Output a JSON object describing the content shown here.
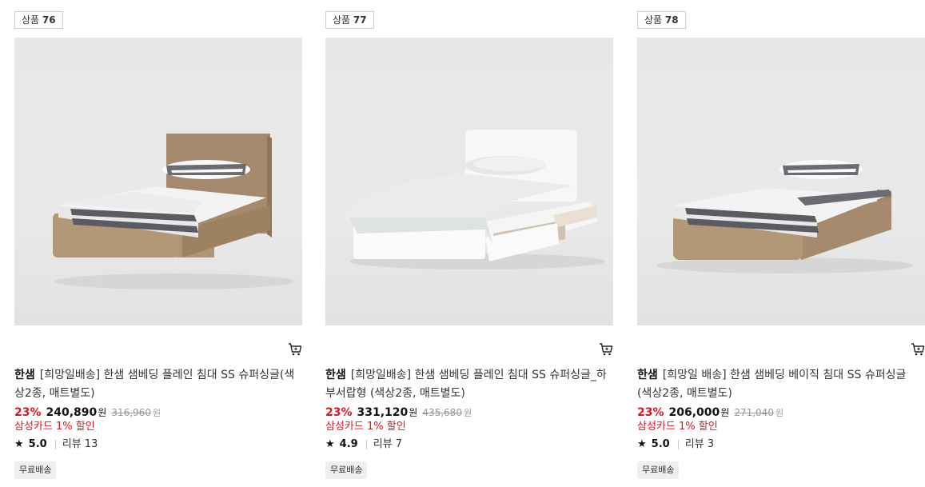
{
  "products": [
    {
      "badge_prefix": "상품",
      "badge_num": "76",
      "brand": "한샘",
      "name": "[희망일배송] 한샘 샘베딩 플레인 침대 SS 슈퍼싱글(색상2종, 매트별도)",
      "discount": "23%",
      "price": "240,890",
      "won": "원",
      "orig_price": "316,960",
      "card_discount": "삼성카드 1% 할인",
      "star": "★",
      "rating": "5.0",
      "review": "리뷰 13",
      "shipping": "무료배송",
      "bed": "wood-headboard"
    },
    {
      "badge_prefix": "상품",
      "badge_num": "77",
      "brand": "한샘",
      "name": "[희망일배송] 한샘 샘베딩 플레인 침대 SS 슈퍼싱글_하부서랍형 (색상2종, 매트별도)",
      "discount": "23%",
      "price": "331,120",
      "won": "원",
      "orig_price": "435,680",
      "card_discount": "삼성카드 1% 할인",
      "star": "★",
      "rating": "4.9",
      "review": "리뷰 7",
      "shipping": "무료배송",
      "bed": "white-drawer"
    },
    {
      "badge_prefix": "상품",
      "badge_num": "78",
      "brand": "한샘",
      "name": "[희망일 배송] 한샘 샘베딩 베이직 침대 SS 슈퍼싱글 (색상2종, 매트별도)",
      "discount": "23%",
      "price": "206,000",
      "won": "원",
      "orig_price": "271,040",
      "card_discount": "삼성카드 1% 할인",
      "star": "★",
      "rating": "5.0",
      "review": "리뷰 3",
      "shipping": "무료배송",
      "bed": "wood-no-headboard"
    }
  ],
  "colors": {
    "discount_red": "#e0161e",
    "wood": "#a68a6d",
    "white_frame": "#f6f6f6",
    "stripe": "#5a5c62"
  },
  "icons": {
    "cart": "cart-icon",
    "star": "star-icon"
  }
}
